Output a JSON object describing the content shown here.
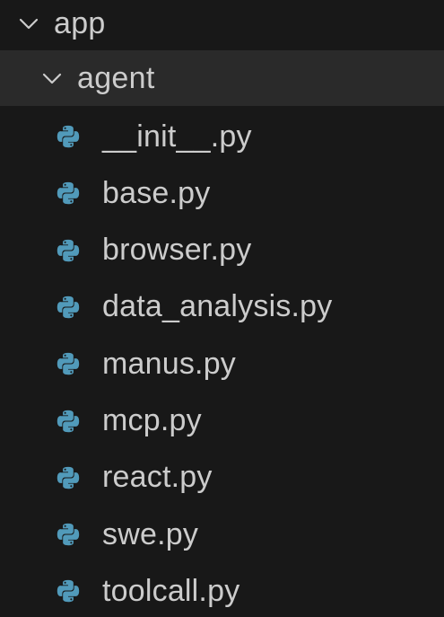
{
  "explorer": {
    "root_folder": {
      "label": "app",
      "expanded": true,
      "icon": "chevron-down-icon"
    },
    "sub_folder": {
      "label": "agent",
      "expanded": true,
      "icon": "chevron-down-icon"
    },
    "files": [
      {
        "label": "__init__.py",
        "icon": "python-icon"
      },
      {
        "label": "base.py",
        "icon": "python-icon"
      },
      {
        "label": "browser.py",
        "icon": "python-icon"
      },
      {
        "label": "data_analysis.py",
        "icon": "python-icon"
      },
      {
        "label": "manus.py",
        "icon": "python-icon"
      },
      {
        "label": "mcp.py",
        "icon": "python-icon"
      },
      {
        "label": "react.py",
        "icon": "python-icon"
      },
      {
        "label": "swe.py",
        "icon": "python-icon"
      },
      {
        "label": "toolcall.py",
        "icon": "python-icon"
      }
    ],
    "colors": {
      "background": "#181818",
      "selected_row": "#2a2a2a",
      "text": "#cccccc",
      "python_icon": "#519aba"
    }
  }
}
